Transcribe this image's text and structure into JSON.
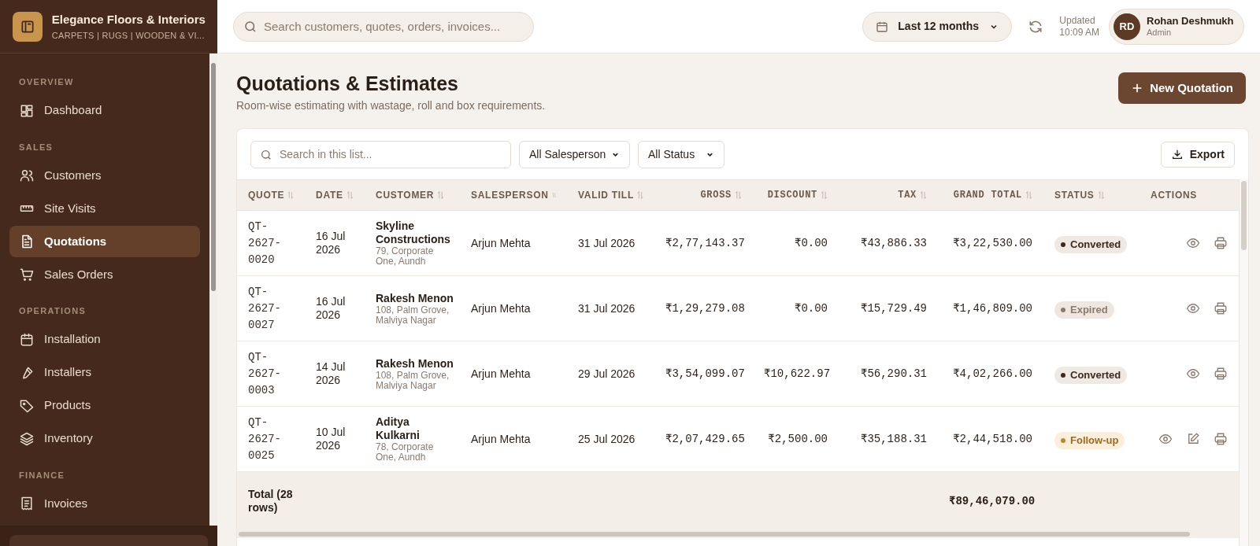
{
  "brand": {
    "name": "Elegance Floors & Interiors",
    "tagline": "CARPETS | RUGS | WOODEN & VI..."
  },
  "sidebar": {
    "sections": [
      {
        "title": "OVERVIEW",
        "items": [
          {
            "label": "Dashboard",
            "selected": false
          }
        ]
      },
      {
        "title": "SALES",
        "items": [
          {
            "label": "Customers",
            "selected": false
          },
          {
            "label": "Site Visits",
            "selected": false
          },
          {
            "label": "Quotations",
            "selected": true
          },
          {
            "label": "Sales Orders",
            "selected": false
          }
        ]
      },
      {
        "title": "OPERATIONS",
        "items": [
          {
            "label": "Installation",
            "selected": false
          },
          {
            "label": "Installers",
            "selected": false
          },
          {
            "label": "Products",
            "selected": false
          },
          {
            "label": "Inventory",
            "selected": false
          }
        ]
      },
      {
        "title": "FINANCE",
        "items": [
          {
            "label": "Invoices",
            "selected": false
          }
        ]
      }
    ]
  },
  "topbar": {
    "search": {
      "placeholder": "Search customers, quotes, orders, invoices..."
    },
    "period": "Last 12 months",
    "updated_label": "Updated",
    "updated_time": "10:09 AM",
    "user": {
      "initials": "RD",
      "name": "Rohan Deshmukh",
      "role": "Admin"
    }
  },
  "page": {
    "title": "Quotations & Estimates",
    "subtitle": "Room-wise estimating with wastage, roll and box requirements.",
    "new_button": "New Quotation"
  },
  "filters": {
    "search": {
      "placeholder": "Search in this list..."
    },
    "salesperson": "All Salesperson",
    "status": "All Status",
    "export": "Export"
  },
  "table": {
    "columns": [
      {
        "label": "QUOTE",
        "kind": "text",
        "sortable": true
      },
      {
        "label": "DATE",
        "kind": "text",
        "sortable": true
      },
      {
        "label": "CUSTOMER",
        "kind": "text",
        "sortable": true
      },
      {
        "label": "SALESPERSON",
        "kind": "text",
        "sortable": true
      },
      {
        "label": "VALID TILL",
        "kind": "text",
        "sortable": true
      },
      {
        "label": "GROSS",
        "kind": "money",
        "sortable": true
      },
      {
        "label": "DISCOUNT",
        "kind": "money",
        "sortable": true
      },
      {
        "label": "TAX",
        "kind": "money",
        "sortable": true
      },
      {
        "label": "GRAND TOTAL",
        "kind": "money",
        "sortable": true
      },
      {
        "label": "STATUS",
        "kind": "text",
        "sortable": true
      },
      {
        "label": "ACTIONS",
        "kind": "text",
        "sortable": false
      }
    ],
    "rows": [
      {
        "quote": "QT-2627-0020",
        "date": "16 Jul 2026",
        "customer": "Skyline Constructions",
        "address": "79, Corporate One, Aundh",
        "salesperson": "Arjun Mehta",
        "valid_till": "31 Jul 2026",
        "gross": "₹2,77,143.37",
        "discount": "₹0.00",
        "tax": "₹43,886.33",
        "grand_total": "₹3,22,530.00",
        "status": {
          "label": "Converted",
          "kind": "converted"
        },
        "editable": false
      },
      {
        "quote": "QT-2627-0027",
        "date": "16 Jul 2026",
        "customer": "Rakesh Menon",
        "address": "108, Palm Grove, Malviya Nagar",
        "salesperson": "Arjun Mehta",
        "valid_till": "31 Jul 2026",
        "gross": "₹1,29,279.08",
        "discount": "₹0.00",
        "tax": "₹15,729.49",
        "grand_total": "₹1,46,809.00",
        "status": {
          "label": "Expired",
          "kind": "expired"
        },
        "editable": false
      },
      {
        "quote": "QT-2627-0003",
        "date": "14 Jul 2026",
        "customer": "Rakesh Menon",
        "address": "108, Palm Grove, Malviya Nagar",
        "salesperson": "Arjun Mehta",
        "valid_till": "29 Jul 2026",
        "gross": "₹3,54,099.07",
        "discount": "₹10,622.97",
        "tax": "₹56,290.31",
        "grand_total": "₹4,02,266.00",
        "status": {
          "label": "Converted",
          "kind": "converted"
        },
        "editable": false
      },
      {
        "quote": "QT-2627-0025",
        "date": "10 Jul 2026",
        "customer": "Aditya Kulkarni",
        "address": "78, Corporate One, Aundh",
        "salesperson": "Arjun Mehta",
        "valid_till": "25 Jul 2026",
        "gross": "₹2,07,429.65",
        "discount": "₹2,500.00",
        "tax": "₹35,188.31",
        "grand_total": "₹2,44,518.00",
        "status": {
          "label": "Follow-up",
          "kind": "followup"
        },
        "editable": true
      }
    ],
    "total": {
      "label": "Total (28 rows)",
      "grand_total": "₹89,46,079.00"
    }
  }
}
